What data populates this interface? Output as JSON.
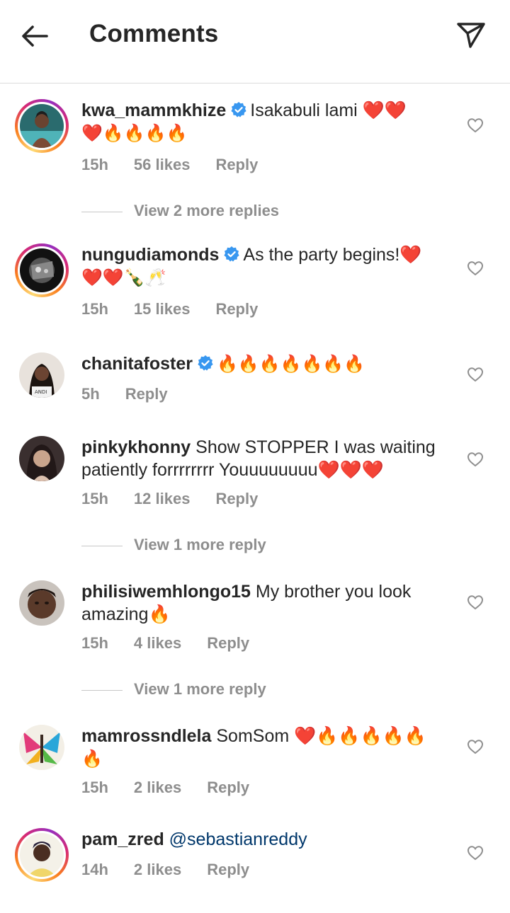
{
  "header": {
    "title": "Comments"
  },
  "comments": [
    {
      "username": "kwa_mammkhize",
      "verified": true,
      "text": "Isakabuli lami ❤️❤️",
      "text2": "❤️🔥🔥🔥🔥",
      "time": "15h",
      "likes": "56 likes",
      "reply": "Reply",
      "view_more": "View 2 more replies"
    },
    {
      "username": "nungudiamonds",
      "verified": true,
      "text": "As the party begins!❤️",
      "text2": "❤️❤️🍾🥂",
      "time": "15h",
      "likes": "15 likes",
      "reply": "Reply"
    },
    {
      "username": "chanitafoster",
      "verified": true,
      "text": "🔥🔥🔥🔥🔥🔥🔥",
      "time": "5h",
      "reply": "Reply"
    },
    {
      "username": "pinkykhonny",
      "verified": false,
      "text": "Show STOPPER I was waiting",
      "text2": "patiently forrrrrrrr Youuuuuuuu❤️❤️❤️",
      "time": "15h",
      "likes": "12 likes",
      "reply": "Reply",
      "view_more": "View 1 more reply"
    },
    {
      "username": "philisiwemhlongo15",
      "verified": false,
      "text": "My brother you look",
      "text2": "amazing🔥",
      "time": "15h",
      "likes": "4 likes",
      "reply": "Reply",
      "view_more": "View 1 more reply"
    },
    {
      "username": "mamrossndlela",
      "verified": false,
      "text": "SomSom ❤️🔥🔥🔥🔥🔥",
      "text2": "🔥",
      "time": "15h",
      "likes": "2 likes",
      "reply": "Reply"
    },
    {
      "username": "pam_zred",
      "verified": false,
      "text": "@sebastianreddy",
      "time": "14h",
      "likes": "2 likes",
      "reply": "Reply"
    }
  ],
  "icons": {
    "back": "arrow-left-icon",
    "share": "paper-plane-icon",
    "like": "heart-outline-icon",
    "verified": "verified-badge-icon"
  },
  "colors": {
    "text": "#262626",
    "secondary": "#8e8e8e",
    "verified": "#3897f0",
    "mention": "#00376b",
    "divider": "#dbdbdb"
  }
}
